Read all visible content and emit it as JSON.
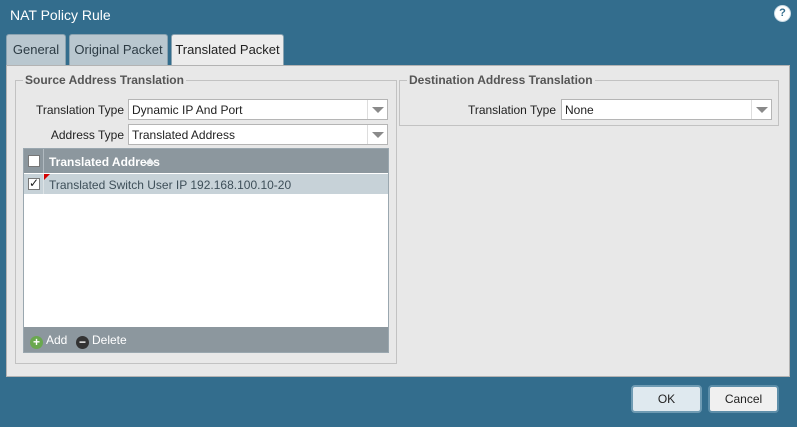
{
  "window": {
    "title": "NAT Policy Rule",
    "help_icon": "?"
  },
  "tabs": [
    {
      "label": "General",
      "active": false
    },
    {
      "label": "Original Packet",
      "active": false
    },
    {
      "label": "Translated Packet",
      "active": true
    }
  ],
  "source": {
    "legend": "Source Address Translation",
    "translation_type_label": "Translation Type",
    "translation_type_value": "Dynamic IP And Port",
    "address_type_label": "Address Type",
    "address_type_value": "Translated Address",
    "grid": {
      "header": "Translated Address",
      "rows": [
        {
          "checked": true,
          "value": "Translated Switch User IP 192.168.100.10-20"
        }
      ],
      "add_label": "Add",
      "delete_label": "Delete"
    }
  },
  "destination": {
    "legend": "Destination Address Translation",
    "translation_type_label": "Translation Type",
    "translation_type_value": "None"
  },
  "buttons": {
    "ok": "OK",
    "cancel": "Cancel"
  },
  "colors": {
    "background": "#336d8d",
    "panel": "#e8e8e8",
    "grid_header": "#8c979e",
    "selected_row": "#c7d2d8"
  }
}
